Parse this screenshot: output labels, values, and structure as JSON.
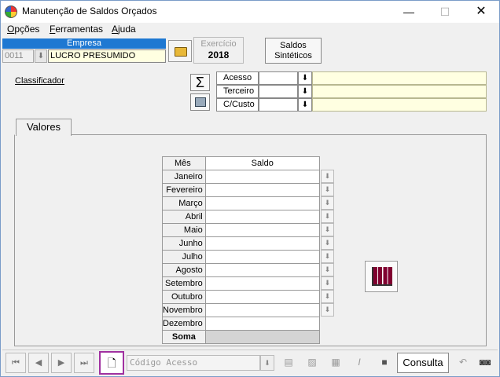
{
  "window": {
    "title": "Manutenção de Saldos Orçados",
    "minimize": "—",
    "maximize": "☐",
    "close": "✕"
  },
  "menu": {
    "items": [
      {
        "label": "Opções",
        "underline": "O",
        "rest": "pções"
      },
      {
        "label": "Ferramentas",
        "underline": "F",
        "rest": "erramentas"
      },
      {
        "label": "Ajuda",
        "underline": "A",
        "rest": "juda"
      }
    ]
  },
  "empresa": {
    "header": "Empresa",
    "code": "0011",
    "name": "LUCRO PRESUMIDO"
  },
  "exercicio": {
    "label": "Exercício",
    "value": "2018"
  },
  "saldos_button": {
    "line1": "Saldos",
    "line2": "Sintéticos"
  },
  "classificador": {
    "label": "Classificador",
    "sum_icon": "Σ",
    "filters": [
      {
        "label": "Acesso",
        "value": "",
        "description": ""
      },
      {
        "label": "Terceiro",
        "value": "",
        "description": ""
      },
      {
        "label": "C/Custo",
        "value": "",
        "description": ""
      }
    ]
  },
  "tab": {
    "label": "Valores"
  },
  "grid": {
    "headers": [
      "Mês",
      "Saldo"
    ],
    "months": [
      "Janeiro",
      "Fevereiro",
      "Março",
      "Abril",
      "Maio",
      "Junho",
      "Julho",
      "Agosto",
      "Setembro",
      "Outubro",
      "Novembro",
      "Dezembro"
    ],
    "values": [
      "",
      "",
      "",
      "",
      "",
      "",
      "",
      "",
      "",
      "",
      "",
      ""
    ],
    "total_label": "Soma",
    "total_value": ""
  },
  "statusbar": {
    "codigo_placeholder": "Código Acesso",
    "mode": "Consulta"
  },
  "icons": {
    "down_arrow": "⬇",
    "first": "⏮",
    "prev": "◀",
    "next": "▶",
    "last": "⏭",
    "new_doc": "🗋"
  },
  "colors": {
    "selection_blue": "#1e78d2",
    "lookup_yellow": "#ffffe1",
    "highlight_purple": "#a030a0"
  }
}
